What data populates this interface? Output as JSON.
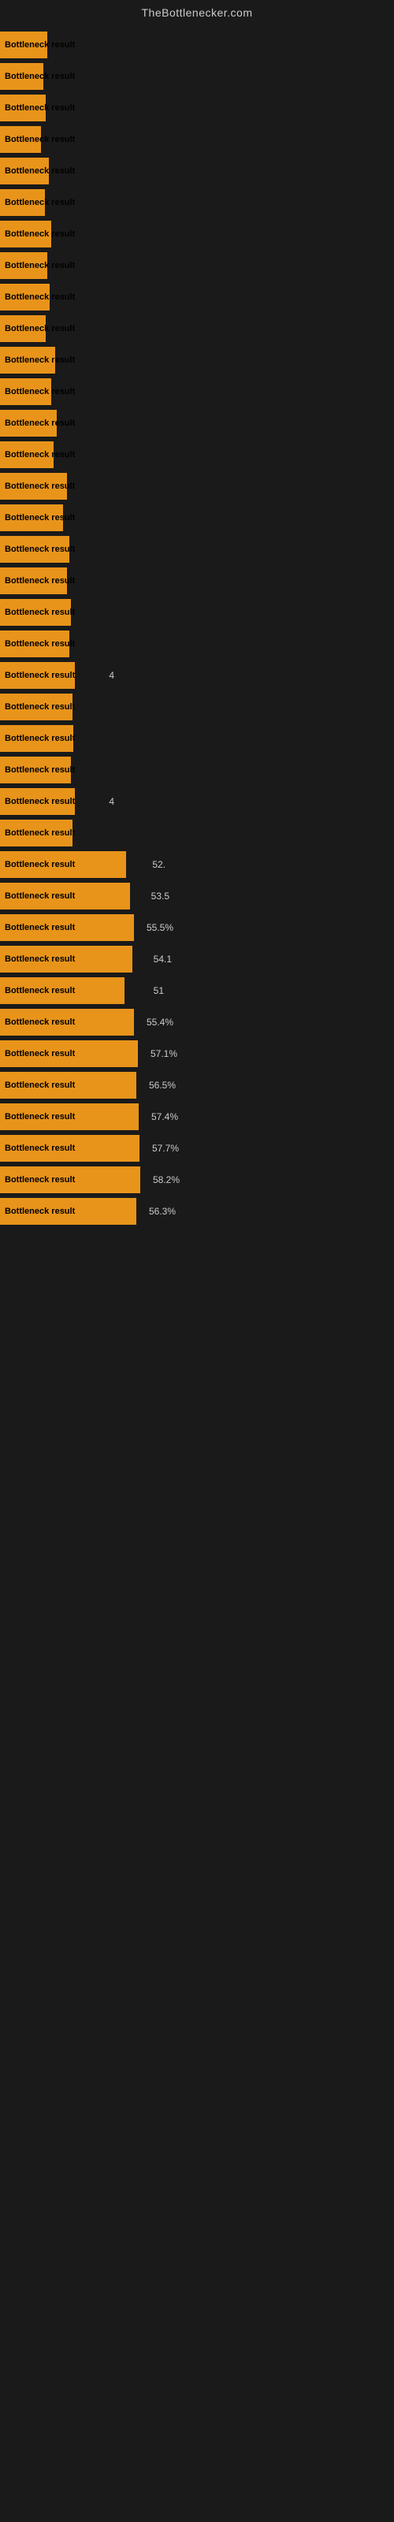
{
  "site": {
    "title": "TheBottlenecker.com"
  },
  "bars": [
    {
      "label": "Bottleneck result",
      "value": null,
      "width": 60
    },
    {
      "label": "Bottleneck result",
      "value": null,
      "width": 55
    },
    {
      "label": "Bottleneck result",
      "value": null,
      "width": 58
    },
    {
      "label": "Bottleneck result",
      "value": null,
      "width": 52
    },
    {
      "label": "Bottleneck result",
      "value": null,
      "width": 62
    },
    {
      "label": "Bottleneck result",
      "value": null,
      "width": 57
    },
    {
      "label": "Bottleneck result",
      "value": null,
      "width": 65
    },
    {
      "label": "Bottleneck result",
      "value": null,
      "width": 60
    },
    {
      "label": "Bottleneck result",
      "value": null,
      "width": 63
    },
    {
      "label": "Bottleneck result",
      "value": null,
      "width": 58
    },
    {
      "label": "Bottleneck result",
      "value": null,
      "width": 70
    },
    {
      "label": "Bottleneck result",
      "value": null,
      "width": 65
    },
    {
      "label": "Bottleneck result",
      "value": null,
      "width": 72
    },
    {
      "label": "Bottleneck result",
      "value": null,
      "width": 68
    },
    {
      "label": "Bottleneck result",
      "value": null,
      "width": 85
    },
    {
      "label": "Bottleneck result",
      "value": null,
      "width": 80
    },
    {
      "label": "Bottleneck result",
      "value": null,
      "width": 88
    },
    {
      "label": "Bottleneck result",
      "value": null,
      "width": 85
    },
    {
      "label": "Bottleneck result",
      "value": null,
      "width": 90
    },
    {
      "label": "Bottleneck result",
      "value": null,
      "width": 88
    },
    {
      "label": "Bottleneck result",
      "value": "4",
      "width": 95
    },
    {
      "label": "Bottleneck result",
      "value": null,
      "width": 92
    },
    {
      "label": "Bottleneck result",
      "value": null,
      "width": 93
    },
    {
      "label": "Bottleneck result",
      "value": null,
      "width": 90
    },
    {
      "label": "Bottleneck result",
      "value": "4",
      "width": 95
    },
    {
      "label": "Bottleneck result",
      "value": null,
      "width": 92
    },
    {
      "label": "Bottleneck result",
      "value": "52.",
      "width": 160
    },
    {
      "label": "Bottleneck result",
      "value": "53.5",
      "width": 165
    },
    {
      "label": "Bottleneck result",
      "value": "55.5%",
      "width": 170
    },
    {
      "label": "Bottleneck result",
      "value": "54.1",
      "width": 168
    },
    {
      "label": "Bottleneck result",
      "value": "51",
      "width": 158
    },
    {
      "label": "Bottleneck result",
      "value": "55.4%",
      "width": 170
    },
    {
      "label": "Bottleneck result",
      "value": "57.1%",
      "width": 175
    },
    {
      "label": "Bottleneck result",
      "value": "56.5%",
      "width": 173
    },
    {
      "label": "Bottleneck result",
      "value": "57.4%",
      "width": 176
    },
    {
      "label": "Bottleneck result",
      "value": "57.7%",
      "width": 177
    },
    {
      "label": "Bottleneck result",
      "value": "58.2%",
      "width": 178
    },
    {
      "label": "Bottleneck result",
      "value": "56.3%",
      "width": 173
    }
  ]
}
